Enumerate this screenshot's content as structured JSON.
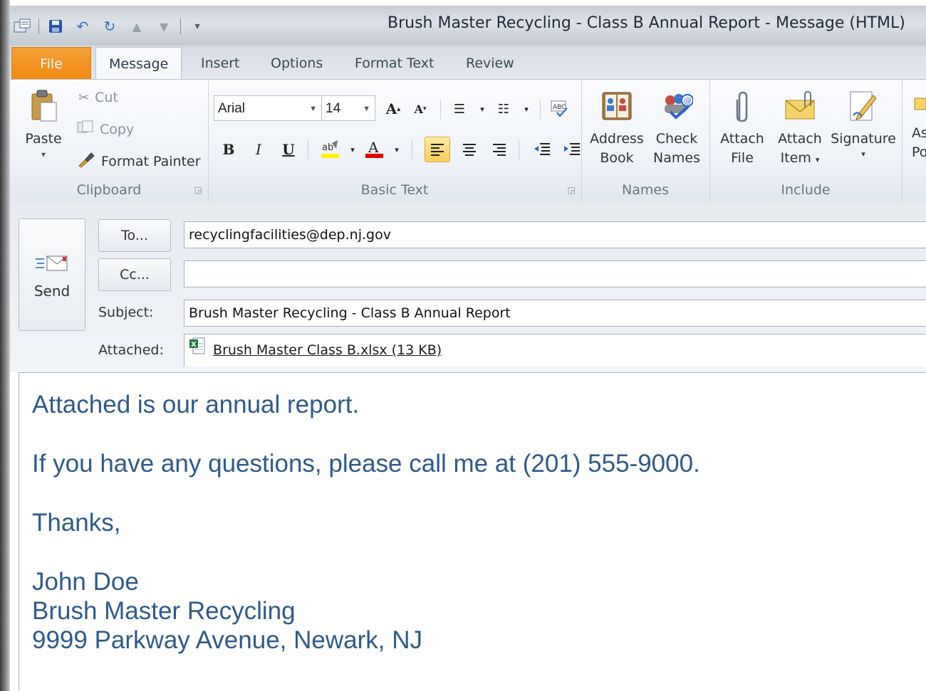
{
  "window": {
    "title": "Brush Master Recycling - Class B Annual Report  -  Message (HTML)"
  },
  "tabs": [
    "File",
    "Message",
    "Insert",
    "Options",
    "Format Text",
    "Review"
  ],
  "clipboard": {
    "paste": "Paste",
    "cut": "Cut",
    "copy": "Copy",
    "format_painter": "Format Painter",
    "label": "Clipboard"
  },
  "basic_text": {
    "font_name": "Arial",
    "font_size": "14",
    "bold": "B",
    "italic": "I",
    "underline": "U",
    "label": "Basic Text"
  },
  "names": {
    "address_book_1": "Address",
    "address_book_2": "Book",
    "check_names_1": "Check",
    "check_names_2": "Names",
    "label": "Names"
  },
  "include": {
    "attach_file_1": "Attach",
    "attach_file_2": "File",
    "attach_item_1": "Attach",
    "attach_item_2": "Item",
    "signature": "Signature",
    "label": "Include"
  },
  "partial": {
    "top": "As",
    "bottom": "Po"
  },
  "compose": {
    "send": "Send",
    "to_button": "To...",
    "cc_button": "Cc...",
    "to_value": "recyclingfacilities@dep.nj.gov",
    "cc_value": "",
    "subject_label": "Subject:",
    "subject_value": "Brush Master Recycling - Class B Annual Report",
    "attached_label": "Attached:",
    "attachment": "Brush Master Class B.xlsx (13 KB)"
  },
  "body": {
    "line1": "Attached is our annual report.",
    "line2": "If you have any questions, please call me at (201) 555-9000.",
    "line3": "Thanks,",
    "sig_name": "John Doe",
    "sig_company": "Brush Master Recycling",
    "sig_address": "9999 Parkway Avenue, Newark, NJ"
  },
  "colors": {
    "file_tab": "#f08a10",
    "body_text": "#2e5a8a",
    "highlight": "#ffef00",
    "font_color": "#e00000"
  }
}
